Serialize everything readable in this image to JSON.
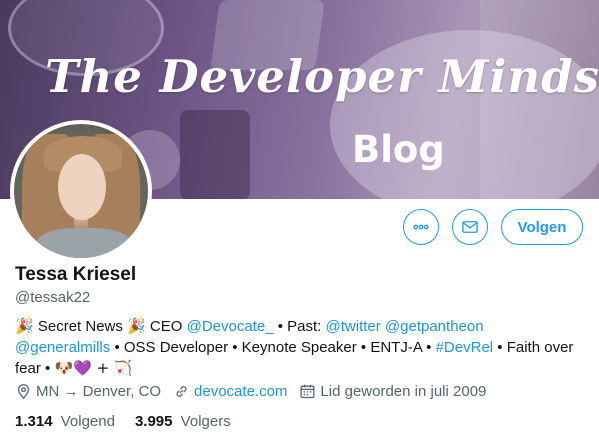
{
  "banner": {
    "title": "The Developer Mindset",
    "subtitle": "Blog"
  },
  "actions": {
    "more_icon": "ellipsis-icon",
    "mail_icon": "envelope-icon",
    "follow_label": "Volgen",
    "accent_color": "#1d9bf0"
  },
  "profile": {
    "name": "Tessa Kriesel",
    "handle": "@tessak22"
  },
  "bio": {
    "party1": "🎉",
    "secret": "Secret News",
    "party2": "🎉",
    "ceo": "CEO",
    "devocate": "@Devocate_",
    "past": "• Past:",
    "twitter": "@twitter",
    "pantheon": "@getpantheon",
    "generalmills": "@generalmills",
    "oss": "• OSS Developer • Keynote Speaker • ENTJ-A •",
    "devrel": "#DevRel",
    "faith": "• Faith over",
    "fear": "fear •",
    "emojis": "🐶💜 + 🏹"
  },
  "meta": {
    "location": "MN → Denver, CO",
    "website": "devocate.com",
    "joined": "Lid geworden in juli 2009"
  },
  "counts": {
    "following_value": "1.314",
    "following_label": "Volgend",
    "followers_value": "3.995",
    "followers_label": "Volgers"
  }
}
